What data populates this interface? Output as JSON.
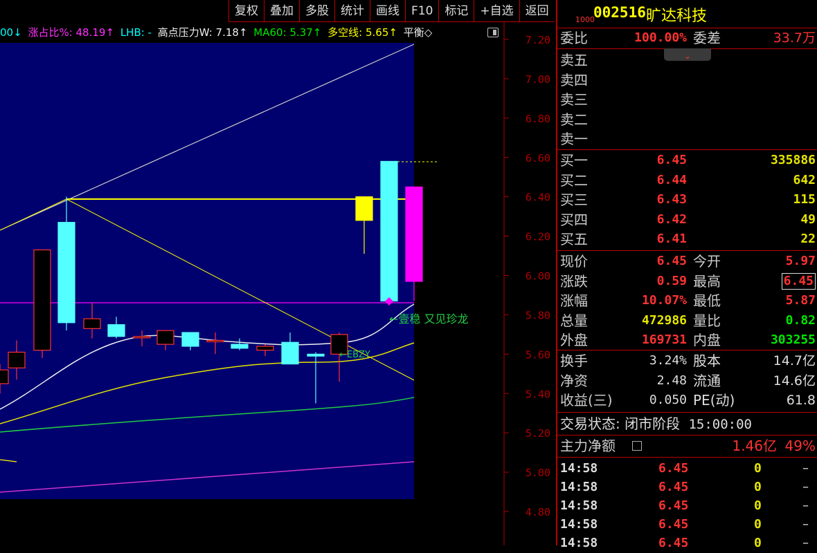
{
  "toolbar": {
    "buttons": [
      "复权",
      "叠加",
      "多股",
      "统计",
      "画线",
      "F10",
      "标记",
      "+自选",
      "返回"
    ]
  },
  "indicators": {
    "prefix": "00↓",
    "zhan_bi": "涨占比%: 48.19↑",
    "lhb": "LHB: -",
    "gao_dian": "高点压力W: 7.18↑",
    "ma60": "MA60: 5.37↑",
    "duo_kong": "多空线: 5.65↑",
    "ping_heng": "平衡◇"
  },
  "price_axis": [
    "7.20",
    "7.00",
    "6.80",
    "6.60",
    "6.40",
    "6.20",
    "6.00",
    "5.80",
    "5.60",
    "5.40",
    "5.20",
    "5.00",
    "4.80"
  ],
  "annotations": {
    "yi_wen": "←壹稳 又见珍龙",
    "ebzy": "←EBZY"
  },
  "stock": {
    "tag": "1000",
    "code": "002516",
    "name": "旷达科技"
  },
  "wei": {
    "wei_bi_label": "委比",
    "wei_bi_value": "100.00%",
    "wei_cha_label": "委差",
    "wei_cha_value": "33.7万"
  },
  "sell": [
    {
      "label": "卖五"
    },
    {
      "label": "卖四"
    },
    {
      "label": "卖三"
    },
    {
      "label": "卖二"
    },
    {
      "label": "卖一"
    }
  ],
  "buy": [
    {
      "label": "买一",
      "price": "6.45",
      "vol": "335886"
    },
    {
      "label": "买二",
      "price": "6.44",
      "vol": "642"
    },
    {
      "label": "买三",
      "price": "6.43",
      "vol": "115"
    },
    {
      "label": "买四",
      "price": "6.42",
      "vol": "49"
    },
    {
      "label": "买五",
      "price": "6.41",
      "vol": "22"
    }
  ],
  "stats": [
    {
      "l1": "现价",
      "v1": "6.45",
      "c1": "red",
      "l2": "今开",
      "v2": "5.97",
      "c2": "red"
    },
    {
      "l1": "涨跌",
      "v1": "0.59",
      "c1": "red",
      "l2": "最高",
      "v2": "6.45",
      "c2": "red"
    },
    {
      "l1": "涨幅",
      "v1": "10.07%",
      "c1": "red",
      "l2": "最低",
      "v2": "5.87",
      "c2": "red"
    },
    {
      "l1": "总量",
      "v1": "472986",
      "c1": "yellow",
      "l2": "量比",
      "v2": "0.82",
      "c2": "green"
    },
    {
      "l1": "外盘",
      "v1": "169731",
      "c1": "red",
      "l2": "内盘",
      "v2": "303255",
      "c2": "green"
    }
  ],
  "stats2": [
    {
      "l1": "换手",
      "v1": "3.24%",
      "l2": "股本",
      "v2": "14.7亿"
    },
    {
      "l1": "净资",
      "v1": "2.48",
      "l2": "流通",
      "v2": "14.6亿"
    },
    {
      "l1": "收益(三)",
      "v1": "0.050",
      "l2": "PE(动)",
      "v2": "61.8"
    }
  ],
  "trade_status": {
    "label": "交易状态:",
    "value": "闭市阶段",
    "time": "15:00:00"
  },
  "main_force": {
    "label": "主力净额",
    "value": "1.46亿",
    "pct": "49%"
  },
  "ticks": [
    {
      "time": "14:58",
      "price": "6.45",
      "vol": "0",
      "flag": "–"
    },
    {
      "time": "14:58",
      "price": "6.45",
      "vol": "0",
      "flag": "–"
    },
    {
      "time": "14:58",
      "price": "6.45",
      "vol": "0",
      "flag": "–"
    },
    {
      "time": "14:58",
      "price": "6.45",
      "vol": "0",
      "flag": "–"
    },
    {
      "time": "14:58",
      "price": "6.45",
      "vol": "0",
      "flag": "–"
    }
  ],
  "colors": {
    "up": "#ff3232",
    "down": "#54ffff",
    "bg_panel": "#00006e",
    "grid": "#b00000",
    "yellow": "#ffff00",
    "magenta": "#ff00ff",
    "green": "#00e600"
  },
  "candles": [
    {
      "o": 5.45,
      "c": 5.52,
      "h": 5.55,
      "l": 5.4
    },
    {
      "o": 5.53,
      "c": 5.61,
      "h": 5.67,
      "l": 5.47
    },
    {
      "o": 5.62,
      "c": 6.13,
      "h": 6.13,
      "l": 5.58
    },
    {
      "o": 6.27,
      "c": 5.76,
      "h": 6.4,
      "l": 5.72
    },
    {
      "o": 5.73,
      "c": 5.78,
      "h": 5.86,
      "l": 5.68
    },
    {
      "o": 5.75,
      "c": 5.69,
      "h": 5.79,
      "l": 5.68
    },
    {
      "o": 5.69,
      "c": 5.69,
      "h": 5.72,
      "l": 5.64
    },
    {
      "o": 5.65,
      "c": 5.72,
      "h": 5.72,
      "l": 5.62
    },
    {
      "o": 5.71,
      "c": 5.64,
      "h": 5.71,
      "l": 5.62
    },
    {
      "o": 5.67,
      "c": 5.67,
      "h": 5.71,
      "l": 5.6
    },
    {
      "o": 5.65,
      "c": 5.63,
      "h": 5.68,
      "l": 5.62
    },
    {
      "o": 5.62,
      "c": 5.64,
      "h": 5.65,
      "l": 5.59
    },
    {
      "o": 5.66,
      "c": 5.55,
      "h": 5.71,
      "l": 5.55
    },
    {
      "o": 5.6,
      "c": 5.59,
      "h": 5.61,
      "l": 5.35
    },
    {
      "o": 5.6,
      "c": 5.7,
      "h": 5.71,
      "l": 5.46
    },
    {
      "o": 6.4,
      "c": 6.28,
      "h": 6.4,
      "l": 6.11
    },
    {
      "o": 6.58,
      "c": 5.87,
      "h": 6.58,
      "l": 5.85
    },
    {
      "o": 6.45,
      "c": 5.97,
      "h": 6.45,
      "l": 5.87
    }
  ]
}
